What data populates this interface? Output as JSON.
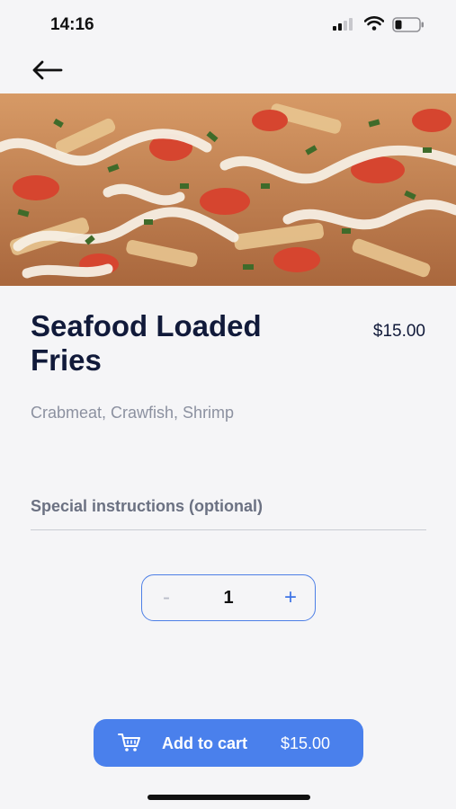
{
  "status_bar": {
    "time": "14:16"
  },
  "item": {
    "title": "Seafood Loaded Fries",
    "price": "$15.00",
    "description": "Crabmeat, Crawfish, Shrimp"
  },
  "instructions": {
    "placeholder": "Special instructions (optional)",
    "value": ""
  },
  "quantity": {
    "minus_label": "-",
    "value": "1",
    "plus_label": "+"
  },
  "cart_button": {
    "label": "Add to cart",
    "price": "$15.00"
  },
  "colors": {
    "accent": "#4a80ec",
    "title": "#111a3a",
    "muted": "#8c91a0"
  },
  "icons": [
    "back-arrow-icon",
    "signal-icon",
    "wifi-icon",
    "battery-icon",
    "cart-icon"
  ]
}
